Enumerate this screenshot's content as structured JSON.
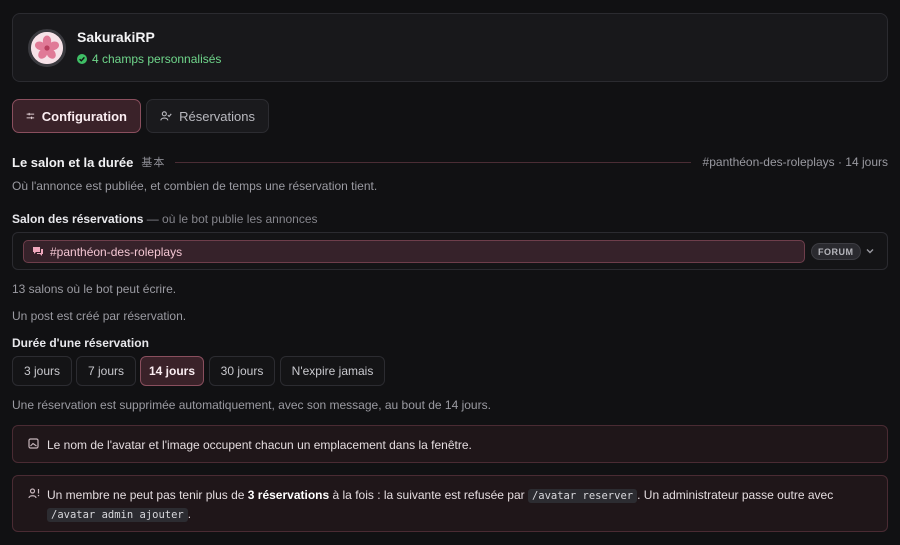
{
  "server": {
    "name": "SakurakiRP",
    "status": "4 champs personnalisés"
  },
  "tabs": [
    {
      "label": "Configuration",
      "active": true
    },
    {
      "label": "Réservations",
      "active": false
    }
  ],
  "section": {
    "title": "Le salon et la durée",
    "kanji": "基本",
    "meta": "#panthéon-des-roleplays · 14 jours",
    "description": "Où l'annonce est publiée, et combien de temps une réservation tient."
  },
  "channel_field": {
    "label": "Salon des réservations",
    "hint": " — où le bot publie les annonces",
    "selected": "#panthéon-des-roleplays",
    "badge": "FORUM",
    "info1": "13 salons où le bot peut écrire.",
    "info2": "Un post est créé par réservation."
  },
  "duration_field": {
    "label": "Durée d'une réservation",
    "options": [
      "3 jours",
      "7 jours",
      "14 jours",
      "30 jours",
      "N'expire jamais"
    ],
    "selected": "14 jours",
    "info": "Une réservation est supprimée automatiquement, avec son message, au bout de 14 jours."
  },
  "notices": {
    "avatar": "Le nom de l'avatar et l'image occupent chacun un emplacement dans la fenêtre.",
    "limit_part1": "Un membre ne peut pas tenir plus de ",
    "limit_bold": "3 réservations",
    "limit_part2": " à la fois : la suivante est refusée par ",
    "limit_code1": "/avatar reserver",
    "limit_part3": ". Un administrateur passe outre avec",
    "limit_code2": "/avatar admin ajouter",
    "limit_part4": "."
  },
  "colors": {
    "accent": "#8a4f5e",
    "success": "#3fbf66",
    "background": "#111113"
  }
}
